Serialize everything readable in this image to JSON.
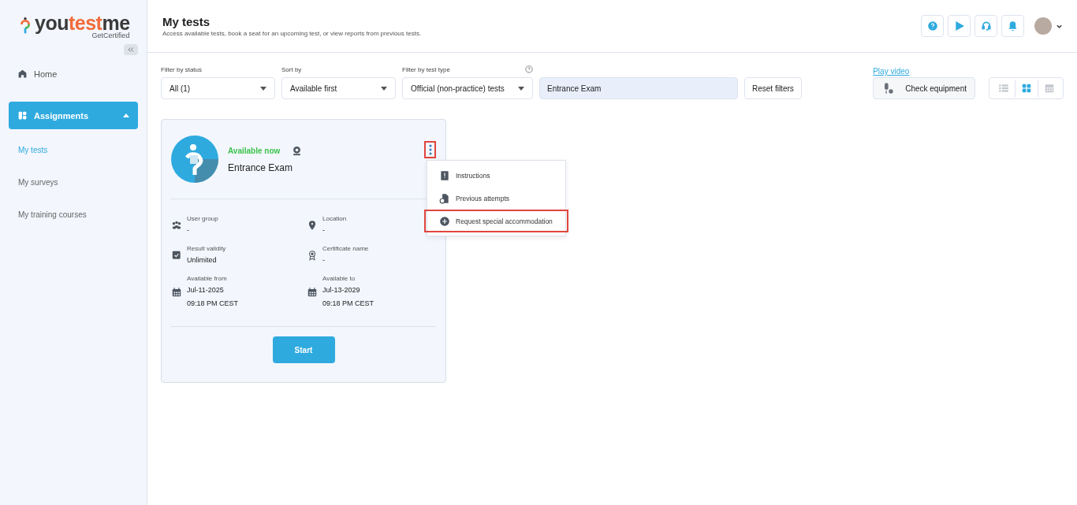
{
  "logo": {
    "parts": [
      {
        "text": "you",
        "color": "#3a3a3a"
      },
      {
        "text": "test",
        "color": "#f26b3a"
      },
      {
        "text": "me",
        "color": "#3a3a3a"
      }
    ],
    "tagline": "GetCertified"
  },
  "sidebar": {
    "items": [
      {
        "label": "Home",
        "kind": "home",
        "selected": false
      },
      {
        "label": "Assignments",
        "kind": "assignments",
        "selected": true,
        "expanded": true,
        "children": [
          {
            "label": "My tests",
            "selected": true
          },
          {
            "label": "My surveys",
            "selected": false
          },
          {
            "label": "My training courses",
            "selected": false
          }
        ]
      }
    ]
  },
  "header": {
    "title": "My tests",
    "subtitle": "Access available tests, book a seat for an upcoming test, or view reports from previous tests."
  },
  "filters": [
    {
      "label": "Filter by status",
      "value": "All (1)",
      "help": false
    },
    {
      "label": "Sort by",
      "value": "Available first",
      "help": false
    },
    {
      "label": "Filter by test type",
      "value": "Official (non-practice) tests",
      "help": true
    }
  ],
  "search": {
    "value": "Entrance Exam"
  },
  "reset_button": "Reset filters",
  "play_video": "Play video",
  "check_equipment": "Check equipment",
  "views": [
    {
      "kind": "list",
      "selected": false
    },
    {
      "kind": "grid",
      "selected": true
    },
    {
      "kind": "calendar",
      "selected": false
    }
  ],
  "card": {
    "status": "Available now",
    "title": "Entrance Exam",
    "proctored": true,
    "menu_highlighted": true,
    "menu": [
      {
        "label": "Instructions",
        "kind": "instructions",
        "highlighted": false
      },
      {
        "label": "Previous attempts",
        "kind": "attempts",
        "highlighted": false
      },
      {
        "label": "Request special accommodation",
        "kind": "request",
        "highlighted": true
      }
    ],
    "details": [
      {
        "kind": "group",
        "label": "User group",
        "lines": [
          "-"
        ]
      },
      {
        "kind": "location",
        "label": "Location",
        "lines": [
          "-"
        ]
      },
      {
        "kind": "validity",
        "label": "Result validity",
        "lines": [
          "Unlimited"
        ]
      },
      {
        "kind": "certificate",
        "label": "Certificate name",
        "lines": [
          "-"
        ]
      },
      {
        "kind": "date",
        "label": "Available from",
        "lines": [
          "Jul-11-2025",
          "09:18 PM CEST"
        ]
      },
      {
        "kind": "date",
        "label": "Available to",
        "lines": [
          "Jul-13-2029",
          "09:18 PM CEST"
        ]
      }
    ],
    "start": "Start"
  }
}
